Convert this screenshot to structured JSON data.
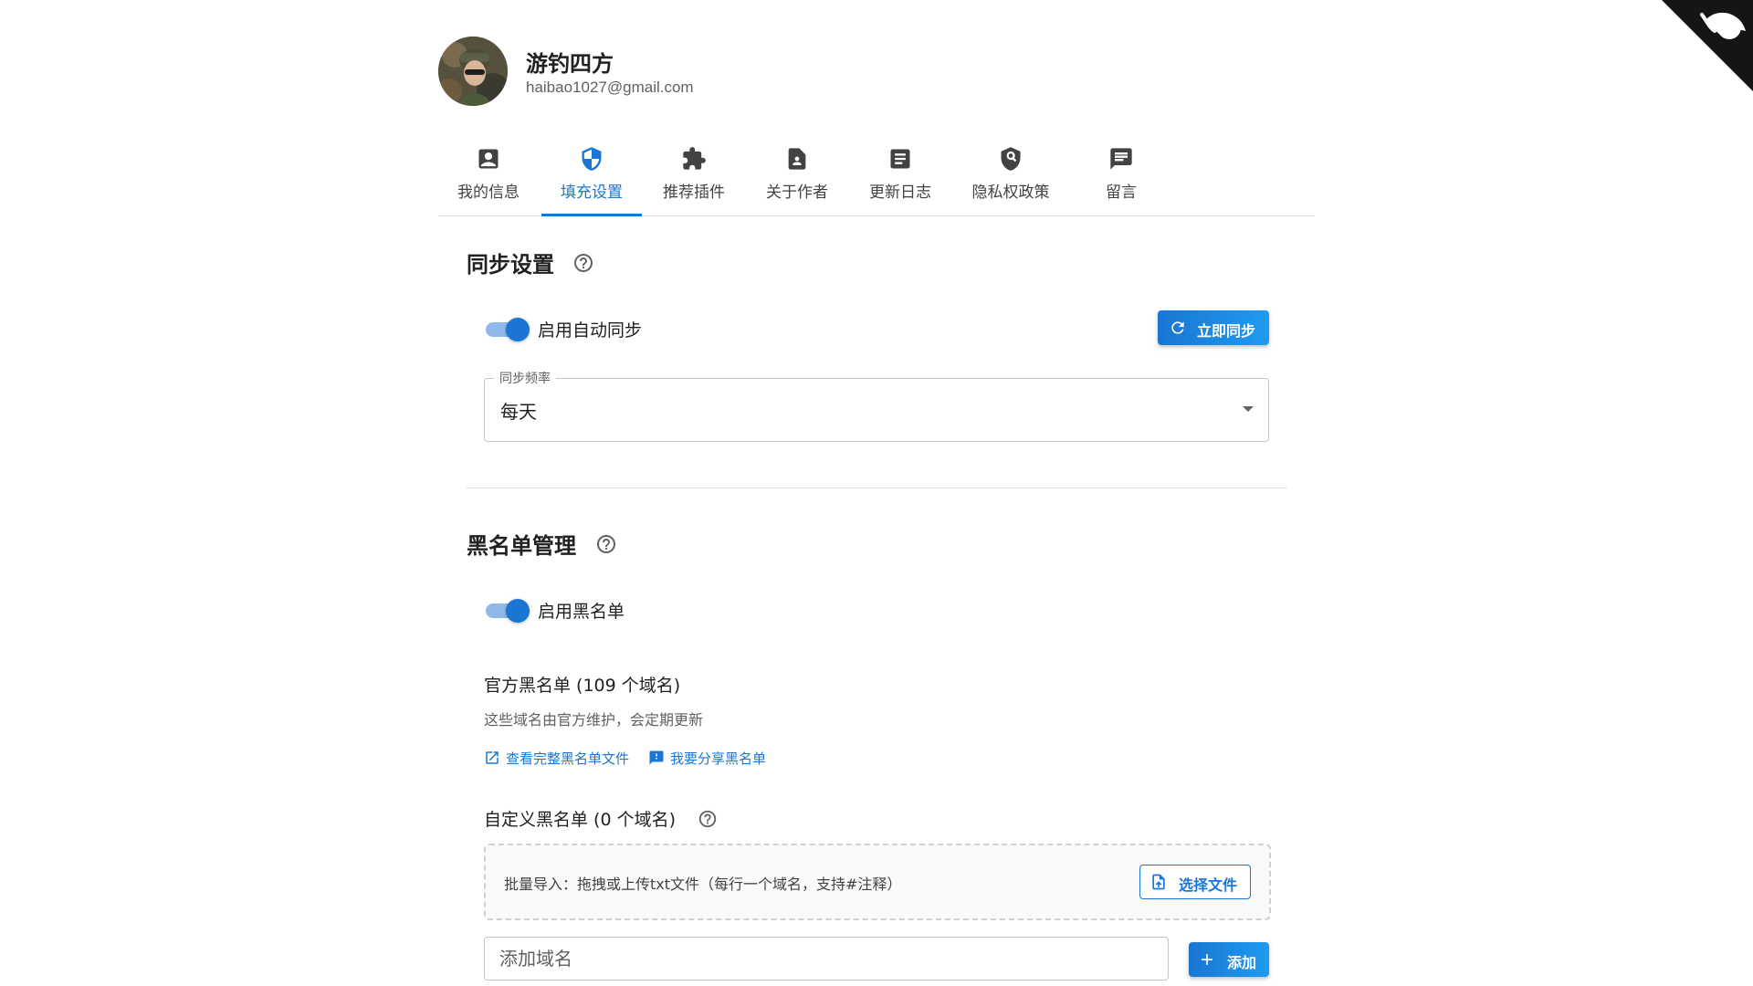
{
  "user": {
    "name": "游钓四方",
    "email": "haibao1027@gmail.com"
  },
  "tabs": [
    {
      "label": "我的信息",
      "icon": "account-box-icon"
    },
    {
      "label": "填充设置",
      "icon": "shield-icon",
      "active": true
    },
    {
      "label": "推荐插件",
      "icon": "puzzle-icon"
    },
    {
      "label": "关于作者",
      "icon": "person-file-icon"
    },
    {
      "label": "更新日志",
      "icon": "document-icon"
    },
    {
      "label": "隐私权政策",
      "icon": "privacy-shield-icon"
    },
    {
      "label": "留言",
      "icon": "message-icon"
    }
  ],
  "sync": {
    "title": "同步设置",
    "auto_sync_label": "启用自动同步",
    "auto_sync_enabled": true,
    "sync_now_label": "立即同步",
    "frequency_label": "同步频率",
    "frequency_value": "每天"
  },
  "blacklist": {
    "title": "黑名单管理",
    "enable_label": "启用黑名单",
    "enabled": true,
    "official_title": "官方黑名单 (109 个域名)",
    "official_desc": "这些域名由官方维护，会定期更新",
    "view_link": "查看完整黑名单文件",
    "share_link": "我要分享黑名单",
    "custom_title": "自定义黑名单 (0 个域名)",
    "import_text": "批量导入：拖拽或上传txt文件（每行一个域名，支持#注释）",
    "choose_file_label": "选择文件",
    "add_placeholder": "添加域名",
    "add_label": "添加"
  },
  "colors": {
    "primary": "#1976d2",
    "switch_track": "#90b8e8"
  }
}
